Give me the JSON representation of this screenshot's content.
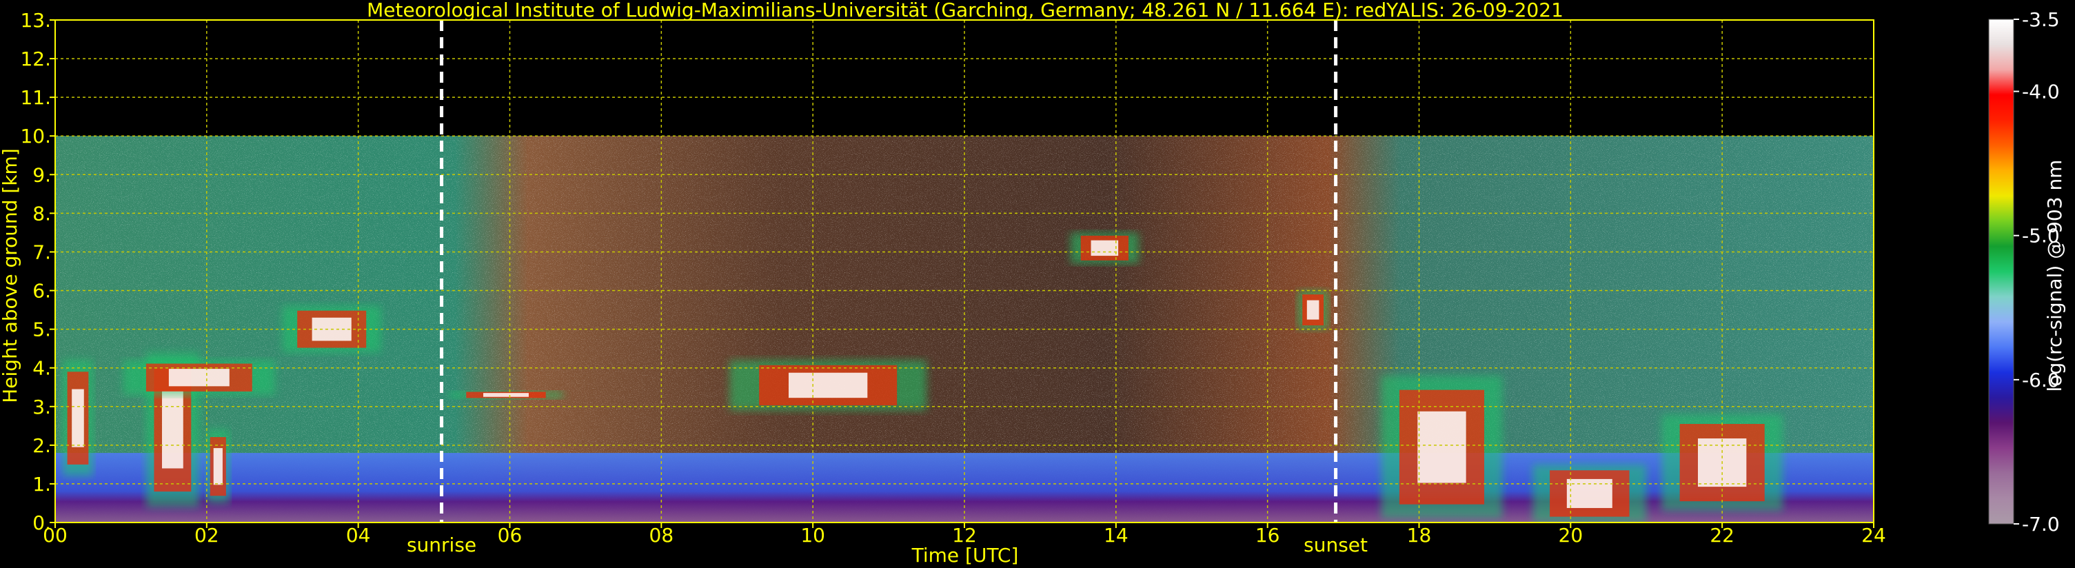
{
  "chart_data": {
    "type": "heatmap",
    "title": "Meteorological Institute of Ludwig-Maximilians-Universität (Garching, Germany; 48.261 N / 11.664 E):    redYALIS: 26-09-2021",
    "xlabel": "Time [UTC]",
    "ylabel": "Height above ground [km]",
    "xlim": [
      0,
      24
    ],
    "ylim": [
      0,
      13
    ],
    "x_ticks": [
      0,
      2,
      4,
      6,
      8,
      10,
      12,
      14,
      16,
      18,
      20,
      22,
      24
    ],
    "x_tick_labels": [
      "00",
      "02",
      "04",
      "06",
      "08",
      "10",
      "12",
      "14",
      "16",
      "18",
      "20",
      "22",
      "24"
    ],
    "y_ticks": [
      0,
      1,
      2,
      3,
      4,
      5,
      6,
      7,
      8,
      9,
      10,
      11,
      12,
      13
    ],
    "y_tick_labels": [
      "0.",
      "1.",
      "2.",
      "3.",
      "4.",
      "5.",
      "6.",
      "7.",
      "8.",
      "9.",
      "10.",
      "11.",
      "12.",
      "13."
    ],
    "grid": true,
    "data_top_km": 10,
    "markers": [
      {
        "label": "sunrise",
        "time": 5.1
      },
      {
        "label": "sunset",
        "time": 16.9
      }
    ],
    "colorbar": {
      "label": "log(rc-signal) @ 903 nm",
      "range": [
        -7.0,
        -3.5
      ],
      "ticks": [
        -3.5,
        -4.0,
        -5.0,
        -6.0,
        -7.0
      ],
      "tick_labels": [
        "-3.5",
        "-4.0",
        "-5.0",
        "-6.0",
        "-7.0"
      ],
      "colors": [
        "#aa9aa8",
        "#a888a6",
        "#9a6c9a",
        "#8a3c8a",
        "#5a1470",
        "#2a1aa0",
        "#1a30e0",
        "#4f7af6",
        "#8fb0f8",
        "#7fd2c8",
        "#1ec86a",
        "#14a030",
        "#78d020",
        "#f0e800",
        "#ffb000",
        "#ff6000",
        "#ff2000",
        "#ff0000",
        "#f2a8a8",
        "#e8e0e0",
        "#ffffff"
      ]
    },
    "features": [
      {
        "kind": "boundary layer",
        "t0": 0,
        "t1": 24,
        "h0": 0,
        "h1": 1.8
      },
      {
        "kind": "cloud",
        "t0": 0.1,
        "t1": 0.5,
        "h0": 1.2,
        "h1": 4.2
      },
      {
        "kind": "cloud",
        "t0": 1.2,
        "t1": 1.9,
        "h0": 0.4,
        "h1": 4.4
      },
      {
        "kind": "cloud",
        "t0": 2.0,
        "t1": 2.3,
        "h0": 0.5,
        "h1": 2.4
      },
      {
        "kind": "cloud",
        "t0": 0.9,
        "t1": 2.9,
        "h0": 3.3,
        "h1": 4.2
      },
      {
        "kind": "cloud",
        "t0": 3.0,
        "t1": 4.3,
        "h0": 4.4,
        "h1": 5.6
      },
      {
        "kind": "cloud",
        "t0": 5.2,
        "t1": 6.7,
        "h0": 3.2,
        "h1": 3.4
      },
      {
        "kind": "cloud",
        "t0": 8.9,
        "t1": 11.5,
        "h0": 2.9,
        "h1": 4.2
      },
      {
        "kind": "cloud",
        "t0": 13.4,
        "t1": 14.3,
        "h0": 6.7,
        "h1": 7.5
      },
      {
        "kind": "cloud",
        "t0": 16.4,
        "t1": 16.8,
        "h0": 5.0,
        "h1": 6.0
      },
      {
        "kind": "cloud",
        "t0": 17.5,
        "t1": 19.1,
        "h0": 0.1,
        "h1": 3.8
      },
      {
        "kind": "cloud",
        "t0": 19.5,
        "t1": 21.0,
        "h0": 0.0,
        "h1": 1.5
      },
      {
        "kind": "cloud",
        "t0": 21.2,
        "t1": 22.8,
        "h0": 0.3,
        "h1": 2.8
      }
    ]
  }
}
